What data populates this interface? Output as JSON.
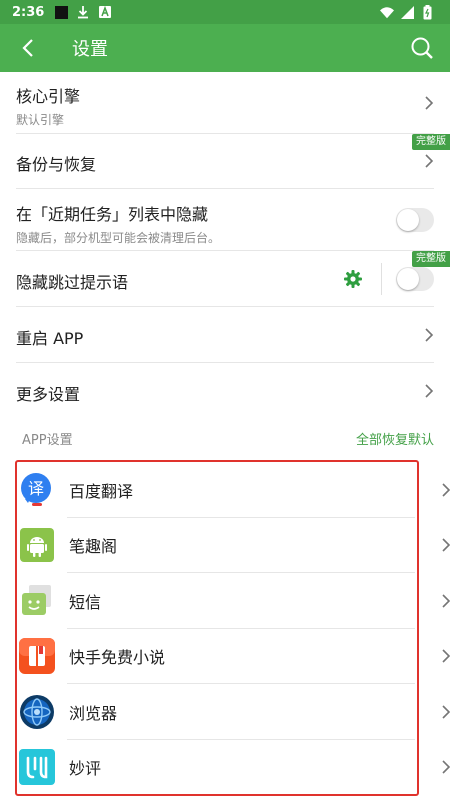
{
  "status_bar": {
    "time": "2:36"
  },
  "app_bar": {
    "title": "设置"
  },
  "settings": [
    {
      "title": "核心引擎",
      "subtitle": "默认引擎"
    },
    {
      "title": "备份与恢复",
      "badge": "完整版"
    },
    {
      "title": "在「近期任务」列表中隐藏",
      "subtitle": "隐藏后，部分机型可能会被清理后台。",
      "toggle": false
    },
    {
      "title": "隐藏跳过提示语",
      "badge": "完整版",
      "toggle": false
    },
    {
      "title": "重启 APP"
    },
    {
      "title": "更多设置"
    }
  ],
  "section": {
    "label": "APP设置",
    "reset_label": "全部恢复默认"
  },
  "apps": [
    {
      "name": "百度翻译",
      "icon": "baidu-translate-icon"
    },
    {
      "name": "笔趣阁",
      "icon": "android-icon"
    },
    {
      "name": "短信",
      "icon": "sms-icon"
    },
    {
      "name": "快手免费小说",
      "icon": "kuaishou-novel-icon"
    },
    {
      "name": "浏览器",
      "icon": "browser-icon"
    },
    {
      "name": "妙评",
      "icon": "miaoping-icon"
    }
  ],
  "colors": {
    "primary": "#4caf50",
    "status_bar": "#43a047",
    "highlight_border": "#e0332d"
  }
}
